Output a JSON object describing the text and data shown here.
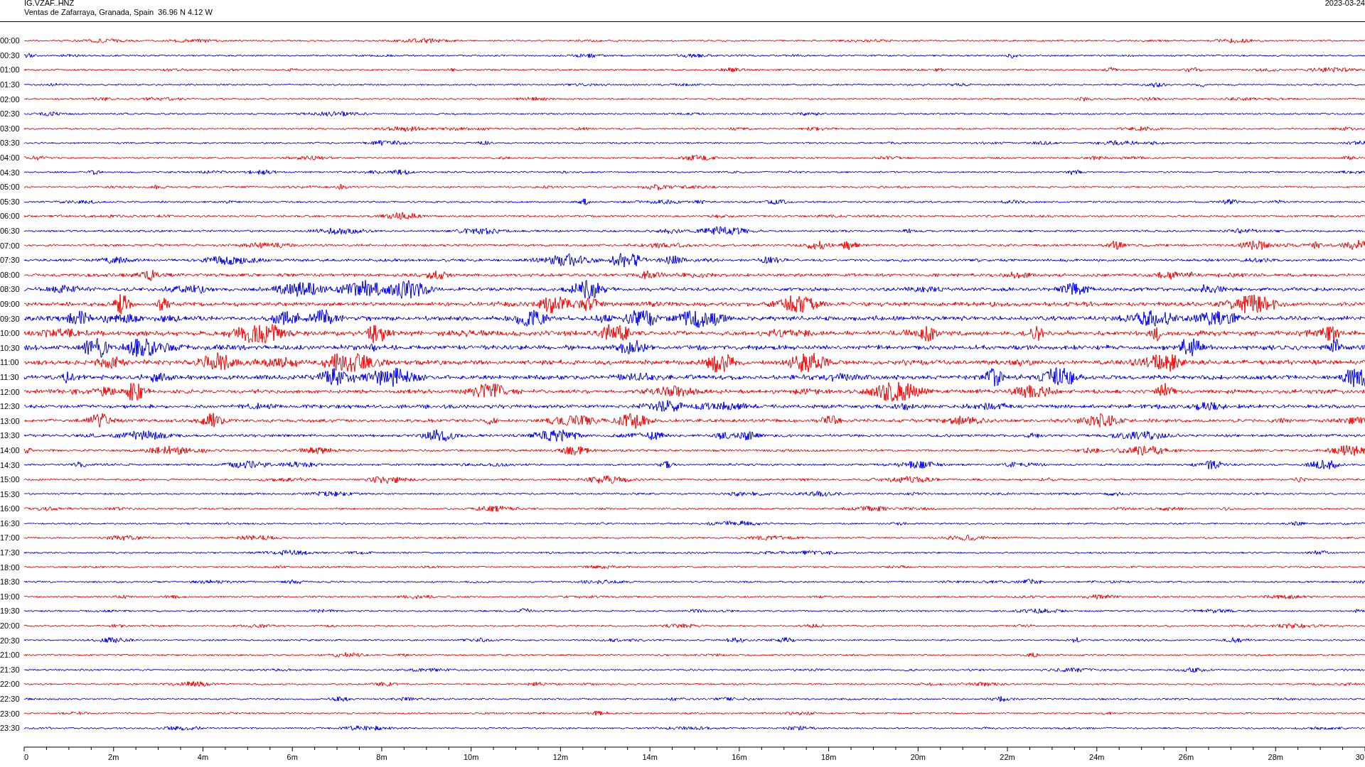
{
  "header": {
    "station": "IG.VZAF..HNZ",
    "location": "Ventas de Zafarraya, Granada, Spain  36.96 N 4.12 W",
    "date": "2023-03-24"
  },
  "traces": [
    {
      "label": "00:00",
      "color": "#ff0000"
    },
    {
      "label": "00:30",
      "color": "#0000ff"
    },
    {
      "label": "01:00",
      "color": "#ff0000"
    },
    {
      "label": "01:30",
      "color": "#0000ff"
    },
    {
      "label": "02:00",
      "color": "#ff0000"
    },
    {
      "label": "02:30",
      "color": "#0000ff"
    },
    {
      "label": "03:00",
      "color": "#ff0000"
    },
    {
      "label": "03:30",
      "color": "#0000ff"
    },
    {
      "label": "04:00",
      "color": "#ff0000"
    },
    {
      "label": "04:30",
      "color": "#0000ff"
    },
    {
      "label": "05:00",
      "color": "#ff0000"
    },
    {
      "label": "05:30",
      "color": "#0000ff"
    },
    {
      "label": "06:00",
      "color": "#ff0000"
    },
    {
      "label": "06:30",
      "color": "#0000ff"
    },
    {
      "label": "07:00",
      "color": "#ff0000"
    },
    {
      "label": "07:30",
      "color": "#0000ff"
    },
    {
      "label": "08:00",
      "color": "#ff0000"
    },
    {
      "label": "08:30",
      "color": "#0000ff"
    },
    {
      "label": "09:00",
      "color": "#ff0000"
    },
    {
      "label": "09:30",
      "color": "#0000ff"
    },
    {
      "label": "10:00",
      "color": "#ff0000"
    },
    {
      "label": "10:30",
      "color": "#0000ff"
    },
    {
      "label": "11:00",
      "color": "#ff0000"
    },
    {
      "label": "11:30",
      "color": "#0000ff"
    },
    {
      "label": "12:00",
      "color": "#ff0000"
    },
    {
      "label": "12:30",
      "color": "#0000ff"
    },
    {
      "label": "13:00",
      "color": "#ff0000"
    },
    {
      "label": "13:30",
      "color": "#0000ff"
    },
    {
      "label": "14:00",
      "color": "#ff0000"
    },
    {
      "label": "14:30",
      "color": "#0000ff"
    },
    {
      "label": "15:00",
      "color": "#ff0000"
    },
    {
      "label": "15:30",
      "color": "#0000ff"
    },
    {
      "label": "16:00",
      "color": "#ff0000"
    },
    {
      "label": "16:30",
      "color": "#0000ff"
    },
    {
      "label": "17:00",
      "color": "#ff0000"
    },
    {
      "label": "17:30",
      "color": "#0000ff"
    },
    {
      "label": "18:00",
      "color": "#ff0000"
    },
    {
      "label": "18:30",
      "color": "#0000ff"
    },
    {
      "label": "19:00",
      "color": "#ff0000"
    },
    {
      "label": "19:30",
      "color": "#0000ff"
    },
    {
      "label": "20:00",
      "color": "#ff0000"
    },
    {
      "label": "20:30",
      "color": "#0000ff"
    },
    {
      "label": "21:00",
      "color": "#ff0000"
    },
    {
      "label": "21:30",
      "color": "#0000ff"
    },
    {
      "label": "22:00",
      "color": "#ff0000"
    },
    {
      "label": "22:30",
      "color": "#0000ff"
    },
    {
      "label": "23:00",
      "color": "#ff0000"
    },
    {
      "label": "23:30",
      "color": "#0000ff"
    }
  ],
  "x_axis": {
    "labels": [
      "0",
      "2m",
      "4m",
      "6m",
      "8m",
      "10m",
      "12m",
      "14m",
      "16m",
      "18m",
      "20m",
      "22m",
      "24m",
      "26m",
      "28m",
      "30"
    ]
  }
}
